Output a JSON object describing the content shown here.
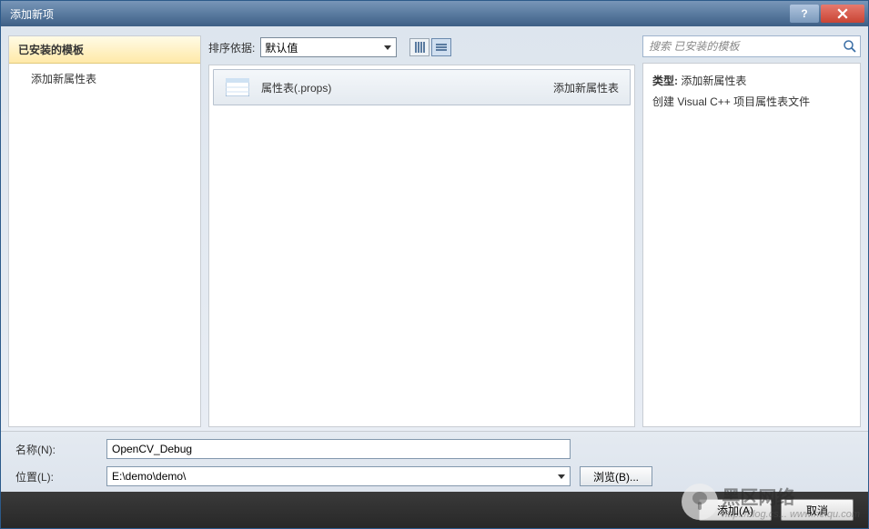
{
  "window": {
    "title": "添加新项"
  },
  "sidebar": {
    "header": "已安装的模板",
    "items": [
      {
        "label": "添加新属性表"
      }
    ]
  },
  "sort": {
    "label": "排序依据:",
    "selected": "默认值"
  },
  "templates": [
    {
      "name": "属性表(.props)",
      "type": "添加新属性表"
    }
  ],
  "search": {
    "placeholder": "搜索 已安装的模板"
  },
  "details": {
    "type_label": "类型:",
    "type_value": "添加新属性表",
    "description": "创建 Visual C++ 项目属性表文件"
  },
  "form": {
    "name_label": "名称(N):",
    "name_value": "OpenCV_Debug",
    "location_label": "位置(L):",
    "location_value": "E:\\demo\\demo\\",
    "browse": "浏览(B)..."
  },
  "footer": {
    "add": "添加(A)",
    "cancel": "取消"
  },
  "watermark": {
    "text1": "黑区网络",
    "text2": "http://blog.cs... www.heiqu.com"
  }
}
